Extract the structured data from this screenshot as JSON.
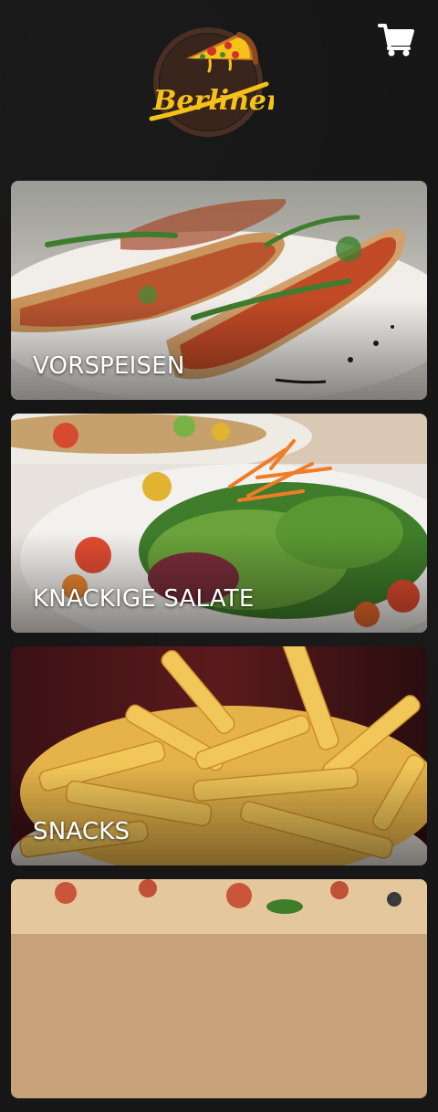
{
  "brand": {
    "logo_text": "Berliner",
    "logo_icon": "pizza-slice-icon"
  },
  "header": {
    "cart_icon": "shopping-cart-icon"
  },
  "categories": [
    {
      "label": "VORSPEISEN",
      "image": "bruschetta-photo"
    },
    {
      "label": "KNACKIGE SALATE",
      "image": "salad-photo"
    },
    {
      "label": "SNACKS",
      "image": "fries-photo"
    },
    {
      "label": "",
      "image": "pizza-photo"
    }
  ],
  "colors": {
    "background": "#171717",
    "logo_yellow": "#f6c21a",
    "logo_brown": "#5a3b2e",
    "text": "#ffffff"
  }
}
